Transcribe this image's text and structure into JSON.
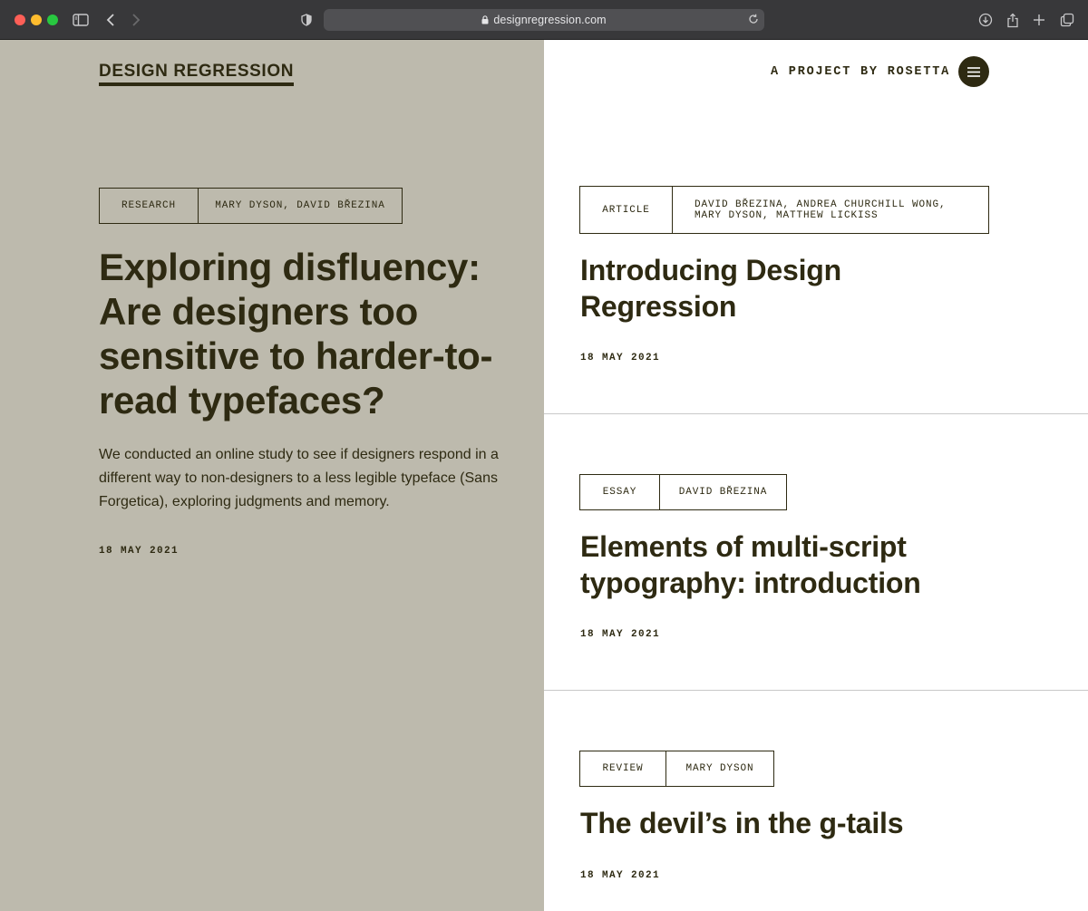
{
  "browser": {
    "url": "designregression.com",
    "icons": [
      "sidebar-icon",
      "back-icon",
      "forward-icon",
      "shield-icon",
      "lock-icon",
      "reload-icon",
      "download-icon",
      "share-icon",
      "new-tab-icon",
      "tabs-overview-icon"
    ]
  },
  "site": {
    "logo": "DESIGN REGRESSION",
    "tagline": "A PROJECT BY ROSETTA",
    "menu_icon": "hamburger-icon"
  },
  "featured": {
    "category": "RESEARCH",
    "authors": "MARY DYSON, DAVID BŘEZINA",
    "title": "Exploring disfluency: Are designers too sensitive to harder-to-read typefaces?",
    "description": "We conducted an online study to see if designers respond in a different way to non-designers to a less legible typeface (Sans Forgetica), exploring judgments and memory.",
    "date": "18 MAY 2021"
  },
  "articles": [
    {
      "category": "ARTICLE",
      "authors": "DAVID BŘEZINA, ANDREA CHURCHILL WONG, MARY DYSON, MATTHEW LICKISS",
      "title": "Introducing Design Regression",
      "date": "18 MAY 2021"
    },
    {
      "category": "ESSAY",
      "authors": "DAVID BŘEZINA",
      "title": "Elements of multi-script typography: introduction",
      "date": "18 MAY 2021"
    },
    {
      "category": "REVIEW",
      "authors": "MARY DYSON",
      "title": "The devil’s in the g-tails",
      "date": "18 MAY 2021"
    }
  ],
  "colors": {
    "ink": "#2e2a12",
    "left_panel": "#bdbaad",
    "right_panel": "#ffffff",
    "chrome": "#38383a"
  }
}
